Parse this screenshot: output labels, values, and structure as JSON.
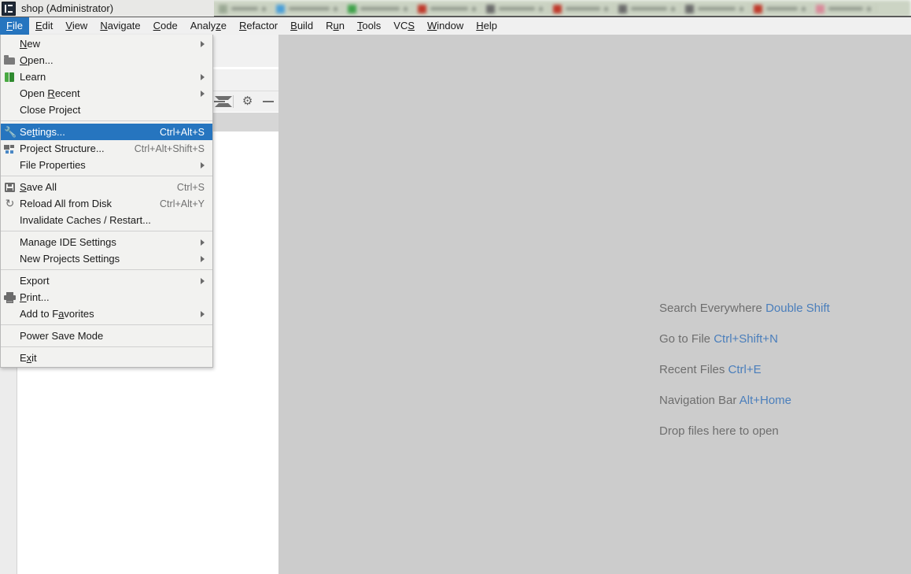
{
  "window": {
    "title": "shop (Administrator)",
    "app_icon": "intellij-idea-icon"
  },
  "menubar": {
    "items": [
      {
        "label": "File",
        "mnemonic": "F",
        "active": true
      },
      {
        "label": "Edit",
        "mnemonic": "E",
        "active": false
      },
      {
        "label": "View",
        "mnemonic": "V",
        "active": false
      },
      {
        "label": "Navigate",
        "mnemonic": "N",
        "active": false
      },
      {
        "label": "Code",
        "mnemonic": "C",
        "active": false
      },
      {
        "label": "Analyze",
        "mnemonic": "z",
        "active": false
      },
      {
        "label": "Refactor",
        "mnemonic": "R",
        "active": false
      },
      {
        "label": "Build",
        "mnemonic": "B",
        "active": false
      },
      {
        "label": "Run",
        "mnemonic": "u",
        "active": false
      },
      {
        "label": "Tools",
        "mnemonic": "T",
        "active": false
      },
      {
        "label": "VCS",
        "mnemonic": "S",
        "active": false
      },
      {
        "label": "Window",
        "mnemonic": "W",
        "active": false
      },
      {
        "label": "Help",
        "mnemonic": "H",
        "active": false
      }
    ]
  },
  "file_menu": {
    "items": [
      {
        "type": "item",
        "label": "New",
        "mnemonic": "N",
        "accel": "",
        "submenu": true,
        "icon": "",
        "selected": false
      },
      {
        "type": "item",
        "label": "Open...",
        "mnemonic": "O",
        "accel": "",
        "submenu": false,
        "icon": "folder-icon",
        "selected": false
      },
      {
        "type": "item",
        "label": "Learn",
        "mnemonic": "",
        "accel": "",
        "submenu": true,
        "icon": "book-icon",
        "selected": false
      },
      {
        "type": "item",
        "label": "Open Recent",
        "mnemonic": "R",
        "accel": "",
        "submenu": true,
        "icon": "",
        "selected": false
      },
      {
        "type": "item",
        "label": "Close Project",
        "mnemonic": "",
        "accel": "",
        "submenu": false,
        "icon": "",
        "selected": false
      },
      {
        "type": "separator"
      },
      {
        "type": "item",
        "label": "Settings...",
        "mnemonic": "t",
        "accel": "Ctrl+Alt+S",
        "submenu": false,
        "icon": "wrench-icon",
        "selected": true
      },
      {
        "type": "item",
        "label": "Project Structure...",
        "mnemonic": "",
        "accel": "Ctrl+Alt+Shift+S",
        "submenu": false,
        "icon": "project-structure-icon",
        "selected": false
      },
      {
        "type": "item",
        "label": "File Properties",
        "mnemonic": "",
        "accel": "",
        "submenu": true,
        "icon": "",
        "selected": false
      },
      {
        "type": "separator"
      },
      {
        "type": "item",
        "label": "Save All",
        "mnemonic": "S",
        "accel": "Ctrl+S",
        "submenu": false,
        "icon": "save-icon",
        "selected": false
      },
      {
        "type": "item",
        "label": "Reload All from Disk",
        "mnemonic": "",
        "accel": "Ctrl+Alt+Y",
        "submenu": false,
        "icon": "reload-icon",
        "selected": false
      },
      {
        "type": "item",
        "label": "Invalidate Caches / Restart...",
        "mnemonic": "",
        "accel": "",
        "submenu": false,
        "icon": "",
        "selected": false
      },
      {
        "type": "separator"
      },
      {
        "type": "item",
        "label": "Manage IDE Settings",
        "mnemonic": "",
        "accel": "",
        "submenu": true,
        "icon": "",
        "selected": false
      },
      {
        "type": "item",
        "label": "New Projects Settings",
        "mnemonic": "",
        "accel": "",
        "submenu": true,
        "icon": "",
        "selected": false
      },
      {
        "type": "separator"
      },
      {
        "type": "item",
        "label": "Export",
        "mnemonic": "",
        "accel": "",
        "submenu": true,
        "icon": "",
        "selected": false
      },
      {
        "type": "item",
        "label": "Print...",
        "mnemonic": "P",
        "accel": "",
        "submenu": false,
        "icon": "print-icon",
        "selected": false
      },
      {
        "type": "item",
        "label": "Add to Favorites",
        "mnemonic": "a",
        "accel": "",
        "submenu": true,
        "icon": "",
        "selected": false
      },
      {
        "type": "separator"
      },
      {
        "type": "item",
        "label": "Power Save Mode",
        "mnemonic": "",
        "accel": "",
        "submenu": false,
        "icon": "",
        "selected": false
      },
      {
        "type": "separator"
      },
      {
        "type": "item",
        "label": "Exit",
        "mnemonic": "x",
        "accel": "",
        "submenu": false,
        "icon": "",
        "selected": false
      }
    ]
  },
  "project_toolbar": {
    "buttons": [
      {
        "icon": "collapse-all-icon"
      },
      {
        "icon": "gear-icon",
        "glyph": "⚙"
      },
      {
        "icon": "minimize-icon"
      }
    ]
  },
  "editor_hints": [
    {
      "text": "Search Everywhere ",
      "key": "Double Shift"
    },
    {
      "text": "Go to File ",
      "key": "Ctrl+Shift+N"
    },
    {
      "text": "Recent Files ",
      "key": "Ctrl+E"
    },
    {
      "text": "Navigation Bar ",
      "key": "Alt+Home"
    },
    {
      "text": "Drop files here to open",
      "key": ""
    }
  ],
  "taskbar_tabs": [
    {
      "favicon": "#9aa893"
    },
    {
      "favicon": "#4a9fd8"
    },
    {
      "favicon": "#3fa14a"
    },
    {
      "favicon": "#c0392b"
    },
    {
      "favicon": "#6b6b6b"
    },
    {
      "favicon": "#c0392b"
    },
    {
      "favicon": "#6b6b6b"
    },
    {
      "favicon": "#6b6b6b"
    },
    {
      "favicon": "#c0392b"
    },
    {
      "favicon": "#d98a9a"
    }
  ],
  "colors": {
    "accent": "#2675bf",
    "menu_bg": "#f2f2f0",
    "editor_bg": "#cccccc",
    "hint_text": "#6e6e6e",
    "hint_key": "#4a7ebb"
  }
}
